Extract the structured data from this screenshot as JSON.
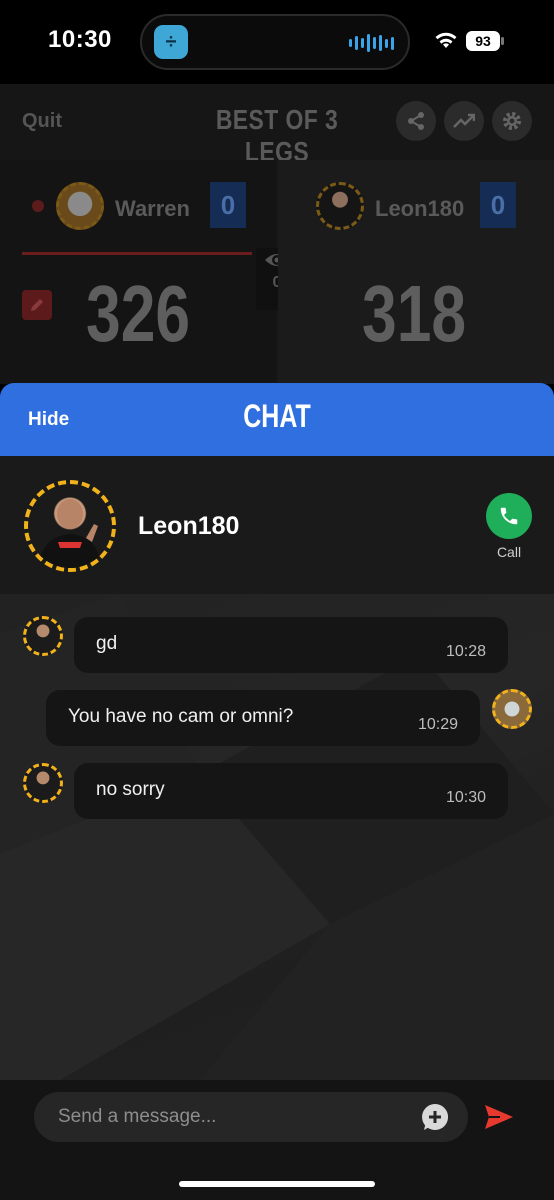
{
  "status_bar": {
    "time": "10:30",
    "battery": "93",
    "icons": [
      "app-icon",
      "audio-wave-icon",
      "wifi-icon",
      "battery-icon"
    ]
  },
  "game": {
    "quit_label": "Quit",
    "title": "BEST OF 3 LEGS",
    "action_icons": [
      "share-icon",
      "stats-trend-icon",
      "settings-gear-icon"
    ],
    "players": [
      {
        "name": "Warren",
        "legs": "0",
        "score": "326",
        "active": true
      },
      {
        "name": "Leon180",
        "legs": "0",
        "score": "318",
        "active": false
      }
    ],
    "spectators": "0"
  },
  "chat": {
    "hide_label": "Hide",
    "title": "CHAT",
    "contact": {
      "name": "Leon180",
      "call_label": "Call"
    },
    "messages": [
      {
        "from": "Leon180",
        "text": "gd",
        "time": "10:28",
        "mine": false
      },
      {
        "from": "Warren",
        "text": "You have no cam or omni?",
        "time": "10:29",
        "mine": true
      },
      {
        "from": "Leon180",
        "text": "no sorry",
        "time": "10:30",
        "mine": false
      }
    ],
    "input": {
      "placeholder": "Send a message...",
      "value": ""
    }
  },
  "colors": {
    "chat_header": "#2f6fe0",
    "call_green": "#1fae5a",
    "send_red": "#e8392e",
    "avatar_ring": "#f2b21b"
  }
}
